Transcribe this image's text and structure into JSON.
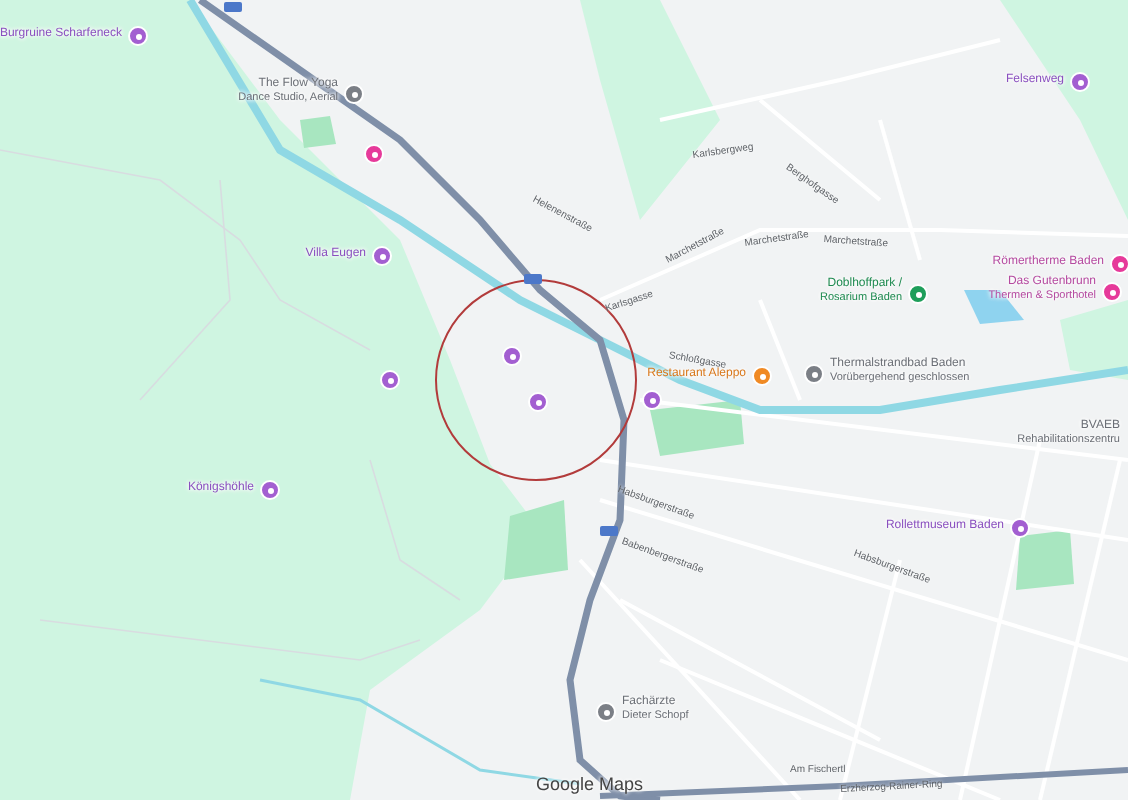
{
  "map": {
    "places": [
      {
        "kind": "attraction",
        "lines": [
          "Burgruine Scharfeneck"
        ]
      },
      {
        "kind": "service",
        "lines": [
          "The Flow Yoga",
          "Dance Studio, Aerial"
        ]
      },
      {
        "kind": "hotel"
      },
      {
        "kind": "attraction",
        "lines": [
          "Villa Eugen"
        ]
      },
      {
        "kind": "attraction",
        "lines": [
          "Königshöhle"
        ]
      },
      {
        "kind": "attraction",
        "lines": [
          "Felsenweg"
        ]
      },
      {
        "kind": "hotel",
        "lines": [
          "Römertherme Baden"
        ]
      },
      {
        "kind": "park",
        "lines": [
          "Doblhoffpark /",
          "Rosarium Baden"
        ]
      },
      {
        "kind": "hotel",
        "lines": [
          "Das Gutenbrunn",
          "Thermen & Sporthotel"
        ]
      },
      {
        "kind": "food",
        "lines": [
          "Restaurant Aleppo"
        ]
      },
      {
        "kind": "service",
        "lines": [
          "Thermalstrandbad Baden",
          "Vorübergehend geschlossen"
        ]
      },
      {
        "kind": "plain",
        "lines": [
          "BVAEB",
          "Rehabilitationszentru"
        ]
      },
      {
        "kind": "attraction",
        "lines": [
          "Rollettmuseum Baden"
        ]
      },
      {
        "kind": "service",
        "lines": [
          "Fachärzte",
          "Dieter Schopf"
        ]
      },
      {
        "kind": "attraction"
      },
      {
        "kind": "attraction"
      },
      {
        "kind": "attraction"
      },
      {
        "kind": "attraction"
      }
    ],
    "streets": [
      "Helenenstraße",
      "Karlsgasse",
      "Marchetstraße",
      "Marchetstraße",
      "Marchetstraße",
      "Berghofgasse",
      "Karlsbergweg",
      "Schloßgasse",
      "Habsburgerstraße",
      "Habsburgerstraße",
      "Babenbergerstraße",
      "Am Fischertl",
      "Erzherzog-Rainer-Ring"
    ],
    "attribution": "Google Maps"
  }
}
